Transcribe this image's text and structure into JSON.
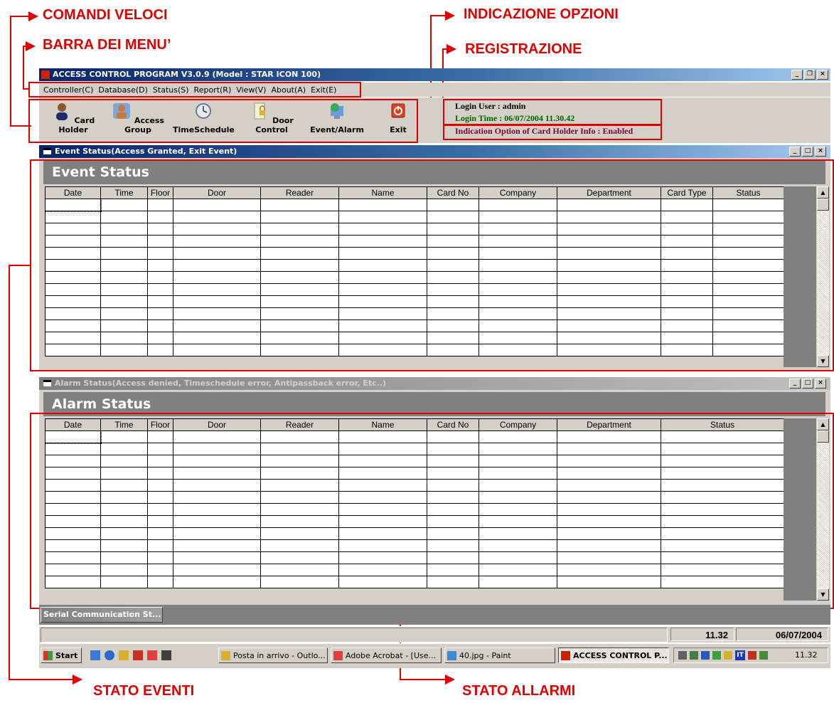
{
  "annotations": {
    "comandi_veloci": "COMANDI VELOCI",
    "barra_menu": "BARRA DEI MENU’",
    "indicazione_opzioni": "INDICAZIONE OPZIONI",
    "registrazione": "REGISTRAZIONE",
    "stato_eventi": "STATO EVENTI",
    "stato_allarmi": "STATO ALLARMI"
  },
  "window": {
    "title": "ACCESS CONTROL PROGRAM V3.0.9 (Model : STAR ICON 100)"
  },
  "menu": [
    "Controller(C)",
    "Database(D)",
    "Status(S)",
    "Report(R)",
    "View(V)",
    "About(A)",
    "Exit(E)"
  ],
  "toolbar": {
    "card_holder": "Card Holder",
    "access_group": "Access Group",
    "time_schedule": "TimeSchedule",
    "door_control": "Door Control",
    "event_alarm": "Event/Alarm",
    "exit": "Exit"
  },
  "login": {
    "user": "Login User : admin",
    "time": "Login Time : 06/07/2004 11.30.42",
    "indication": "Indication Option of Card Holder Info :  Enabled"
  },
  "event_panel": {
    "title": "Event Status(Access Granted, Exit Event)",
    "heading": "Event Status",
    "columns": [
      "Date",
      "Time",
      "Floor",
      "Door",
      "Reader",
      "Name",
      "Card No",
      "Company",
      "Department",
      "Card Type",
      "Status"
    ]
  },
  "alarm_panel": {
    "title": "Alarm Status(Access denied, Timeschedule error, Antipassback error, Etc..)",
    "heading": "Alarm Status",
    "columns": [
      "Date",
      "Time",
      "Floor",
      "Door",
      "Reader",
      "Name",
      "Card No",
      "Company",
      "Department",
      "Status"
    ]
  },
  "serial_tab": "Serial Communication St...",
  "statusbar": {
    "time": "11.32",
    "date": "06/07/2004"
  },
  "taskbar": {
    "start": "Start",
    "items": [
      "Posta in arrivo - Outlo...",
      "Adobe Acrobat - [Use...",
      "40.jpg - Paint",
      "ACCESS CONTROL P..."
    ],
    "tray_lang": "IT",
    "clock": "11.32"
  },
  "colors": {
    "annotation_red": "#e00000",
    "titlebar_active": "#0a246a",
    "titlebar_inactive": "#808080",
    "window_face": "#d4d0c8"
  }
}
